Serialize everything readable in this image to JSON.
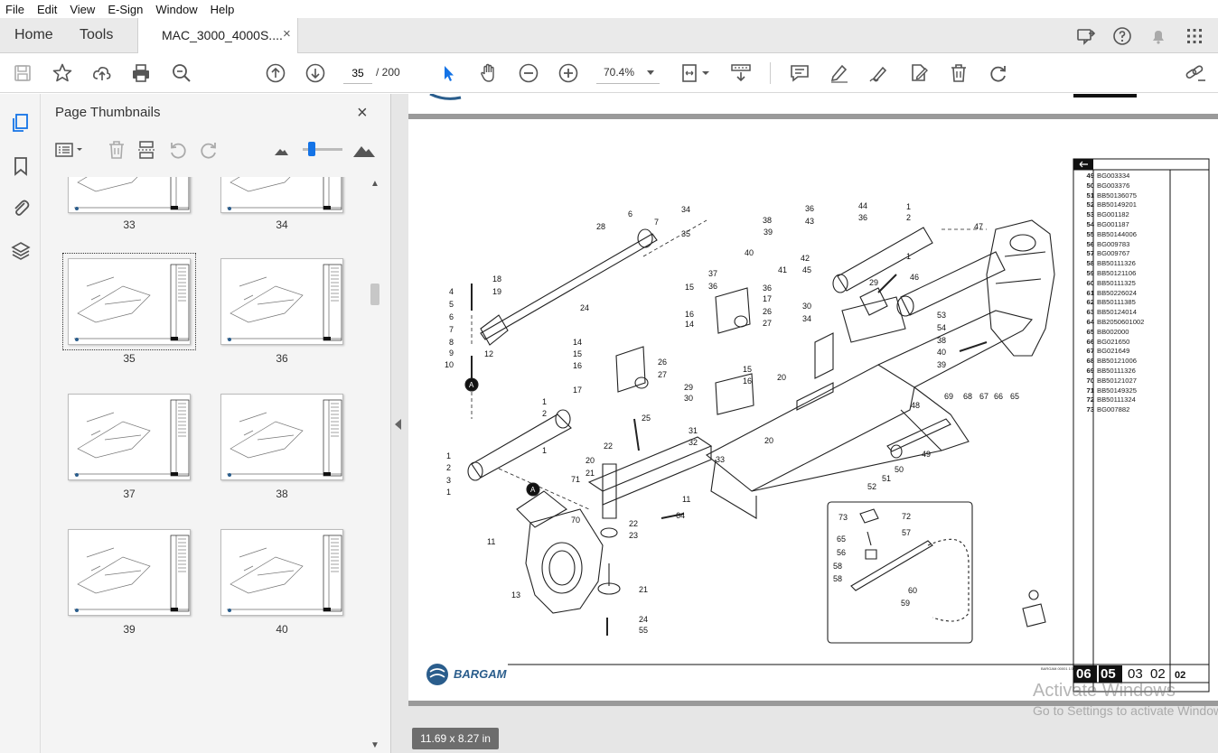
{
  "menu": [
    "File",
    "Edit",
    "View",
    "E-Sign",
    "Window",
    "Help"
  ],
  "tabs": {
    "home": "Home",
    "tools": "Tools",
    "document": "MAC_3000_4000S....",
    "close": "×"
  },
  "toolbar": {
    "page_current": "35",
    "page_total": "/ 200",
    "zoom": "70.4%"
  },
  "panel": {
    "title": "Page Thumbnails",
    "close": "×",
    "thumbnails": [
      "33",
      "34",
      "35",
      "36",
      "37",
      "38",
      "39",
      "40"
    ],
    "selected": "35"
  },
  "document": {
    "size": "11.69 x 8.27 in",
    "brand": "BARGAM",
    "code_blocks": [
      "06",
      "05",
      "03",
      "02"
    ],
    "code_suffix": "02",
    "small_ref": "BARGAM.00001 1/12",
    "parts": [
      [
        "49",
        "BG003334"
      ],
      [
        "50",
        "BG003376"
      ],
      [
        "51",
        "BB50136075"
      ],
      [
        "52",
        "BB50149201"
      ],
      [
        "53",
        "BG001182"
      ],
      [
        "54",
        "BG001187"
      ],
      [
        "55",
        "BB50144006"
      ],
      [
        "56",
        "BG009783"
      ],
      [
        "57",
        "BG009767"
      ],
      [
        "58",
        "BB50111326"
      ],
      [
        "59",
        "BB50121106"
      ],
      [
        "60",
        "BB50111325"
      ],
      [
        "61",
        "BB50226024"
      ],
      [
        "62",
        "BB50111385"
      ],
      [
        "63",
        "BB50124014"
      ],
      [
        "64",
        "BB2050601002"
      ],
      [
        "65",
        "BB002000"
      ],
      [
        "66",
        "BG021650"
      ],
      [
        "67",
        "BG021649"
      ],
      [
        "68",
        "BB50121006"
      ],
      [
        "69",
        "BB50111326"
      ],
      [
        "70",
        "BB50121027"
      ],
      [
        "71",
        "BB50149325"
      ],
      [
        "72",
        "BB50111324"
      ],
      [
        "73",
        "BG007882"
      ]
    ],
    "callouts": [
      "1",
      "2",
      "3",
      "4",
      "5",
      "6",
      "7",
      "8",
      "9",
      "10",
      "11",
      "12",
      "13",
      "14",
      "15",
      "16",
      "17",
      "18",
      "19",
      "20",
      "21",
      "22",
      "23",
      "24",
      "25",
      "26",
      "27",
      "28",
      "29",
      "30",
      "31",
      "32",
      "33",
      "34",
      "35",
      "36",
      "37",
      "38",
      "39",
      "40",
      "41",
      "42",
      "43",
      "44",
      "45",
      "46",
      "47",
      "48",
      "49",
      "50",
      "51",
      "52",
      "53",
      "54",
      "55",
      "56",
      "57",
      "58",
      "59",
      "60",
      "64",
      "65",
      "66",
      "67",
      "68",
      "69",
      "70",
      "71",
      "72",
      "73",
      "A"
    ]
  },
  "watermark": {
    "line1": "Activate Windows",
    "line2": "Go to Settings to activate Windows."
  },
  "colors": {
    "accent": "#1473e6",
    "brand": "#2a5d8c"
  }
}
